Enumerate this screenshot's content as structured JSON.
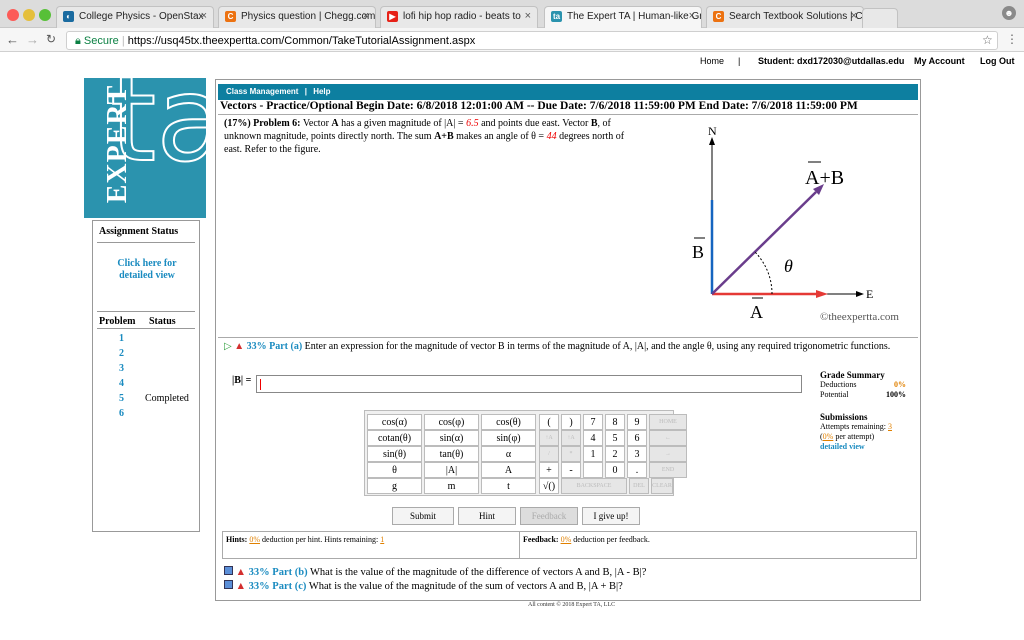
{
  "browser": {
    "tabs": [
      {
        "label": "College Physics - OpenStax",
        "fav": "◐",
        "color": "#1a6ba0"
      },
      {
        "label": "Physics question | Chegg.com",
        "fav": "C",
        "color": "#ec7211"
      },
      {
        "label": "lofi hip hop radio - beats to",
        "fav": "▶",
        "color": "#e62117"
      },
      {
        "label": "The Expert TA | Human-like Gr",
        "fav": "ta",
        "color": "#2b93ae"
      },
      {
        "label": "Search Textbook Solutions | Ch",
        "fav": "C",
        "color": "#ec7211"
      }
    ],
    "secure_label": "Secure",
    "url": "https://usq45tx.theexpertta.com/Common/TakeTutorialAssignment.aspx"
  },
  "topnav": {
    "home": "Home",
    "sep": "|",
    "student": "Student: dxd172030@utdallas.edu",
    "my_account": "My Account",
    "log_out": "Log Out"
  },
  "logo": {
    "text": "EXPERT",
    "big": "ta"
  },
  "sidebar": {
    "assignment_status": "Assignment Status",
    "click_here": "Click here for detailed view",
    "problem_header": "Problem",
    "status_header": "Status",
    "problems": [
      {
        "num": "1",
        "status": ""
      },
      {
        "num": "2",
        "status": ""
      },
      {
        "num": "3",
        "status": ""
      },
      {
        "num": "4",
        "status": ""
      },
      {
        "num": "5",
        "status": "Completed"
      },
      {
        "num": "6",
        "status": ""
      }
    ]
  },
  "header": {
    "class_mgmt": "Class Management",
    "sep": "|",
    "help": "Help",
    "dates": "Vectors - Practice/Optional Begin Date: 6/8/2018 12:01:00 AM -- Due Date: 7/6/2018 11:59:00 PM End Date: 7/6/2018 11:59:00 PM"
  },
  "problem": {
    "pct": "(17%)",
    "title": "Problem 6:",
    "text1": "Vector",
    "A": "A",
    "text2": "has a given magnitude of |A| =",
    "mag": "6.5",
    "text3": "and points due east. Vector",
    "B": "B",
    "text4": ", of unknown magnitude, points directly north. The sum",
    "text5": "makes an angle of θ =",
    "angle": "44",
    "text6": "degrees north of east. Refer to the figure."
  },
  "figure": {
    "N": "N",
    "E": "E",
    "AB": "A+B",
    "Bvec": "B",
    "Avec": "A",
    "theta": "θ",
    "copyright": "©theexpertta.com"
  },
  "partA": {
    "label": "33% Part (a)",
    "text": "Enter an expression for the magnitude of vector B in terms of the magnitude of A, |A|, and the angle θ, using any required trigonometric functions.",
    "input_label": "|B| ="
  },
  "keypad": {
    "fn": [
      [
        "cos(α)",
        "cos(φ)",
        "cos(θ)"
      ],
      [
        "cotan(θ)",
        "sin(α)",
        "sin(φ)"
      ],
      [
        "sin(θ)",
        "tan(θ)",
        "α"
      ],
      [
        "θ",
        "|A|",
        "A"
      ],
      [
        "g",
        "m",
        "t"
      ]
    ],
    "nums": [
      [
        "(",
        ")",
        "7",
        "8",
        "9",
        "HOME"
      ],
      [
        "↑A",
        "↑A",
        "4",
        "5",
        "6",
        "←"
      ],
      [
        "/",
        "*",
        "1",
        "2",
        "3",
        "→"
      ],
      [
        "+",
        "-",
        "",
        "0",
        ".",
        "END"
      ]
    ],
    "bottom": [
      "√()",
      "BACKSPACE",
      "DEL",
      "CLEAR"
    ]
  },
  "buttons": {
    "submit": "Submit",
    "hint": "Hint",
    "feedback": "Feedback",
    "give_up": "I give up!"
  },
  "grade": {
    "title": "Grade Summary",
    "deductions_label": "Deductions",
    "deductions": "0%",
    "potential_label": "Potential",
    "potential": "100%",
    "submissions_title": "Submissions",
    "attempts_label": "Attempts remaining:",
    "attempts": "3",
    "per_attempt_pct": "0%",
    "per_attempt": "per attempt)",
    "detailed": "detailed view"
  },
  "hints": {
    "label": "Hints:",
    "pct": "0%",
    "text": "deduction per hint. Hints remaining:",
    "remaining": "1",
    "fb_label": "Feedback:",
    "fb_pct": "0%",
    "fb_text": "deduction per feedback."
  },
  "parts": [
    {
      "label": "33% Part (b)",
      "text": "What is the value of the magnitude of the difference of vectors A and B, |A - B|?"
    },
    {
      "label": "33% Part (c)",
      "text": "What is the value of the magnitude of the sum of vectors A and B, |A + B|?"
    }
  ],
  "footer": "All content © 2018 Expert TA, LLC"
}
